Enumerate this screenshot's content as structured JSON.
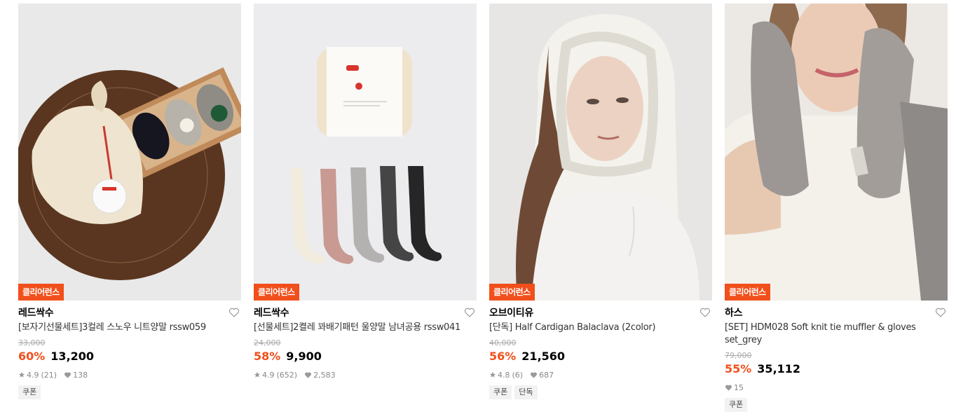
{
  "products": [
    {
      "badge": "클리어런스",
      "brand": "레드싹수",
      "title": "[보자기선물세트]3컬레 스노우 니트양말 rssw059",
      "original_price": "33,000",
      "discount": "60%",
      "price": "13,200",
      "rating": "4.9",
      "reviews": "(21)",
      "likes": "138",
      "tags": [
        "쿠폰"
      ]
    },
    {
      "badge": "클리어런스",
      "brand": "레드싹수",
      "title": "[선물세트]2켤레 꽈배기패턴 울양말 남녀공용 rssw041",
      "original_price": "24,000",
      "discount": "58%",
      "price": "9,900",
      "rating": "4.9",
      "reviews": "(652)",
      "likes": "2,583",
      "tags": []
    },
    {
      "badge": "클리어런스",
      "brand": "오브이티유",
      "title": "[단독] Half Cardigan Balaclava (2color)",
      "original_price": "40,000",
      "discount": "56%",
      "price": "21,560",
      "rating": "4.8",
      "reviews": "(6)",
      "likes": "687",
      "tags": [
        "쿠폰",
        "단독"
      ]
    },
    {
      "badge": "클리어런스",
      "brand": "하스",
      "title": "[SET] HDM028 Soft knit tie muffler & gloves set_grey",
      "original_price": "79,000",
      "discount": "55%",
      "price": "35,112",
      "likes": "15",
      "tags": [
        "쿠폰"
      ]
    }
  ],
  "colors": {
    "accent": "#f14f1b",
    "text": "#000000",
    "muted": "#888888"
  }
}
